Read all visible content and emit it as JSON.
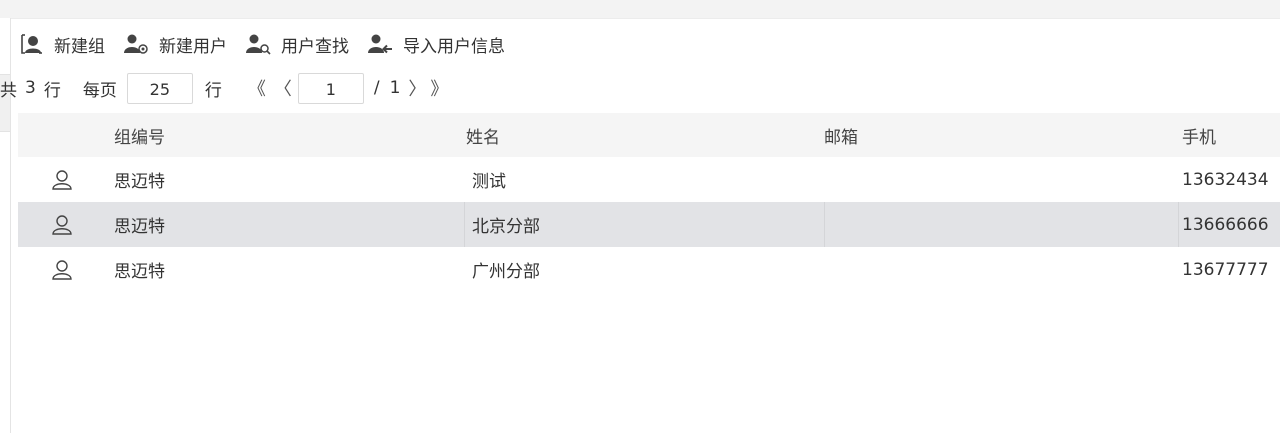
{
  "toolbar": {
    "new_group": "新建组",
    "new_user": "新建用户",
    "find_user": "用户查找",
    "import_user": "导入用户信息"
  },
  "pager": {
    "total_prefix": "共",
    "total_count": "3",
    "total_suffix": "行",
    "per_page_label": "每页",
    "per_page_value": "25",
    "per_page_suffix": "行",
    "first": "《",
    "prev": "〈",
    "current_page": "1",
    "page_sep": "/",
    "page_total": "1",
    "next": "〉",
    "last": "》"
  },
  "table": {
    "columns": [
      "组编号",
      "姓名",
      "邮箱",
      "手机"
    ],
    "rows": [
      {
        "group": "思迈特",
        "name": "测试",
        "email": "",
        "phone": "13632434"
      },
      {
        "group": "思迈特",
        "name": "北京分部",
        "email": "",
        "phone": "13666666"
      },
      {
        "group": "思迈特",
        "name": "广州分部",
        "email": "",
        "phone": "13677777"
      }
    ]
  },
  "colors": {
    "header_bg": "#f5f5f5",
    "selected_row_bg": "#e2e3e6",
    "icon_color": "#444444"
  }
}
